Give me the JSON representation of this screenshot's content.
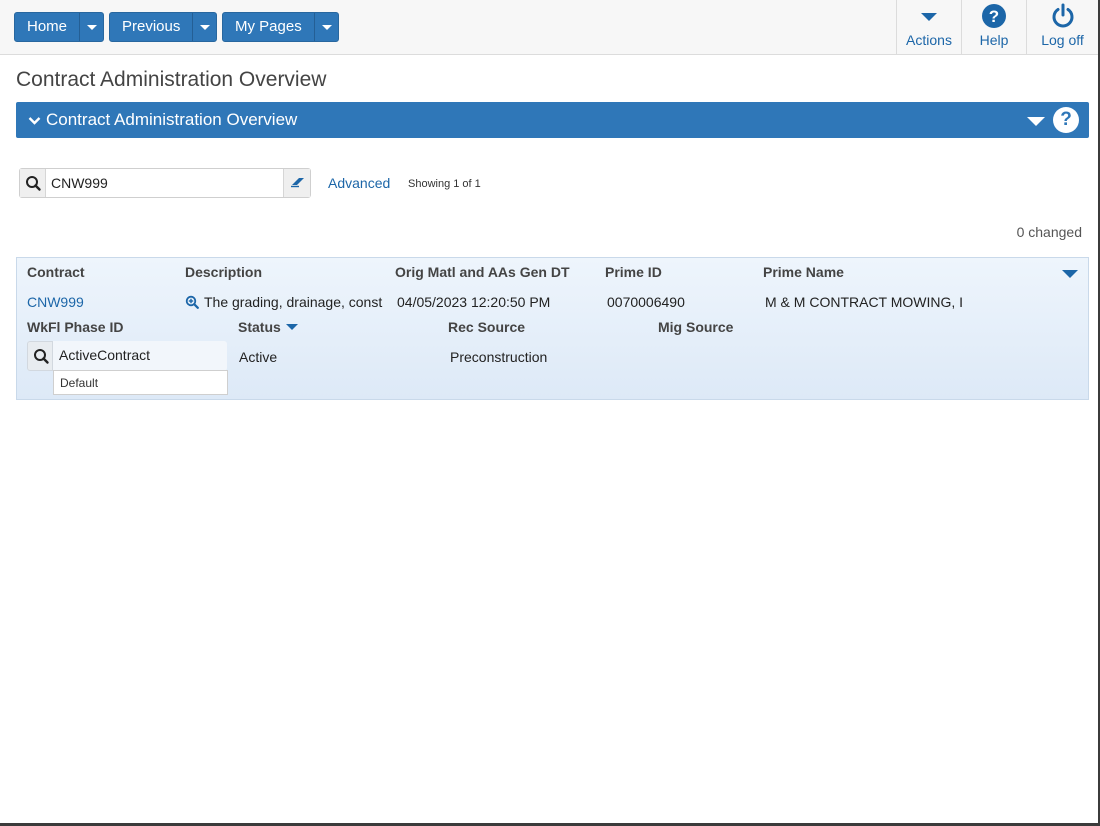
{
  "nav": {
    "home_label": "Home",
    "previous_label": "Previous",
    "mypages_label": "My Pages"
  },
  "top_actions": {
    "actions_label": "Actions",
    "help_label": "Help",
    "logoff_label": "Log off"
  },
  "page": {
    "title": "Contract Administration Overview",
    "panel_title": "Contract Administration Overview"
  },
  "search": {
    "value": "CNW999",
    "advanced_label": "Advanced",
    "showing_text": "Showing 1 of 1"
  },
  "changed_text": "0 changed",
  "grid": {
    "headers": {
      "contract": "Contract",
      "description": "Description",
      "orig_matl": "Orig Matl and AAs Gen DT",
      "prime_id": "Prime ID",
      "prime_name": "Prime Name",
      "wkfl_phase": "WkFl Phase ID",
      "status": "Status",
      "rec_source": "Rec Source",
      "mig_source": "Mig Source"
    },
    "row": {
      "contract": "CNW999",
      "description": "The grading, drainage, const",
      "orig_matl": "04/05/2023 12:20:50 PM",
      "prime_id": "0070006490",
      "prime_name": "M & M CONTRACT MOWING, I",
      "wkfl_phase": "ActiveContract",
      "wkfl_phase_option": "Default",
      "status": "Active",
      "rec_source": "Preconstruction",
      "mig_source": ""
    }
  },
  "colors": {
    "primary": "#2f77b8",
    "link": "#1c66a8",
    "grid_bg": "#e6eff9"
  },
  "icons": [
    "caret-down-icon",
    "help-icon",
    "power-icon",
    "search-icon",
    "eraser-icon",
    "chevron-down-icon",
    "zoom-in-icon"
  ]
}
